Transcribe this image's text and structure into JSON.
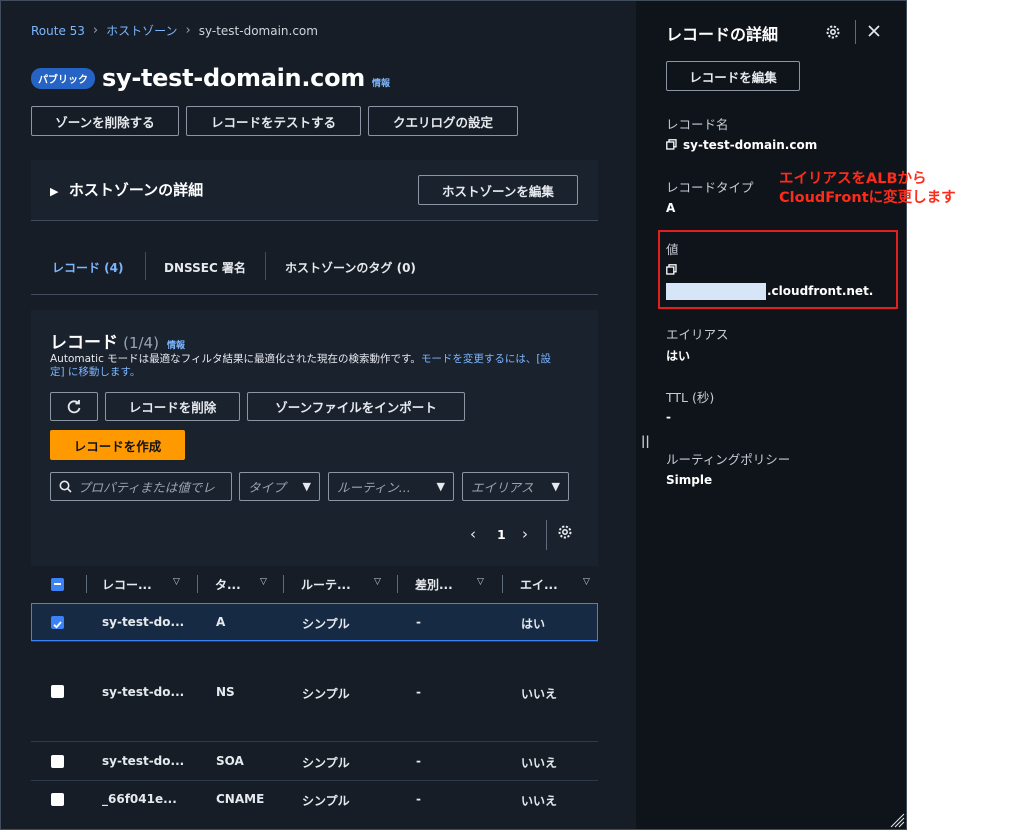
{
  "breadcrumb": {
    "root": "Route 53",
    "zones": "ホストゾーン",
    "current": "sy-test-domain.com"
  },
  "zone": {
    "badge": "パブリック",
    "name": "sy-test-domain.com",
    "info": "情報",
    "buttons": {
      "delete": "ゾーンを削除する",
      "test": "レコードをテストする",
      "query_log": "クエリログの設定"
    }
  },
  "details": {
    "title": "ホストゾーンの詳細",
    "edit": "ホストゾーンを編集"
  },
  "tabs": [
    "レコード (4)",
    "DNSSEC 署名",
    "ホストゾーンのタグ (0)"
  ],
  "records": {
    "title": "レコード",
    "count": "(1/4)",
    "info": "情報",
    "notice": "Automatic モードは最適なフィルタ結果に最適化された現在の検索動作です。",
    "notice_link": "モードを変更するには、[設定] に移動します。",
    "buttons": {
      "delete": "レコードを削除",
      "import": "ゾーンファイルをインポート",
      "create": "レコードを作成"
    },
    "search_placeholder": "プロパティまたは値でレ",
    "filters": {
      "type": "タイプ",
      "routing": "ルーティン...",
      "alias": "エイリアス"
    },
    "page": "1",
    "columns": [
      "レコー...",
      "タ...",
      "ルーテ...",
      "差別...",
      "エイ..."
    ],
    "rows": [
      {
        "name": "sy-test-do...",
        "type": "A",
        "routing": "シンプル",
        "diff": "-",
        "alias": "はい",
        "checked": true
      },
      {
        "name": "sy-test-do...",
        "type": "NS",
        "routing": "シンプル",
        "diff": "-",
        "alias": "いいえ",
        "checked": false
      },
      {
        "name": "sy-test-do...",
        "type": "SOA",
        "routing": "シンプル",
        "diff": "-",
        "alias": "いいえ",
        "checked": false
      },
      {
        "name": "_66f041e...",
        "type": "CNAME",
        "routing": "シンプル",
        "diff": "-",
        "alias": "いいえ",
        "checked": false
      }
    ]
  },
  "panel": {
    "title": "レコードの詳細",
    "edit": "レコードを編集",
    "name_label": "レコード名",
    "name_value": "sy-test-domain.com",
    "type_label": "レコードタイプ",
    "type_value": "A",
    "value_label": "値",
    "value_suffix": ".cloudfront.net.",
    "alias_label": "エイリアス",
    "alias_value": "はい",
    "ttl_label": "TTL (秒)",
    "ttl_value": "-",
    "routing_label": "ルーティングポリシー",
    "routing_value": "Simple"
  },
  "annotation": {
    "line1": "エイリアスをALBから",
    "line2": "CloudFrontに変更します"
  },
  "colors": {
    "accent": "#ff9900",
    "link": "#7cb6ff",
    "annotation": "#ff2b1a"
  }
}
